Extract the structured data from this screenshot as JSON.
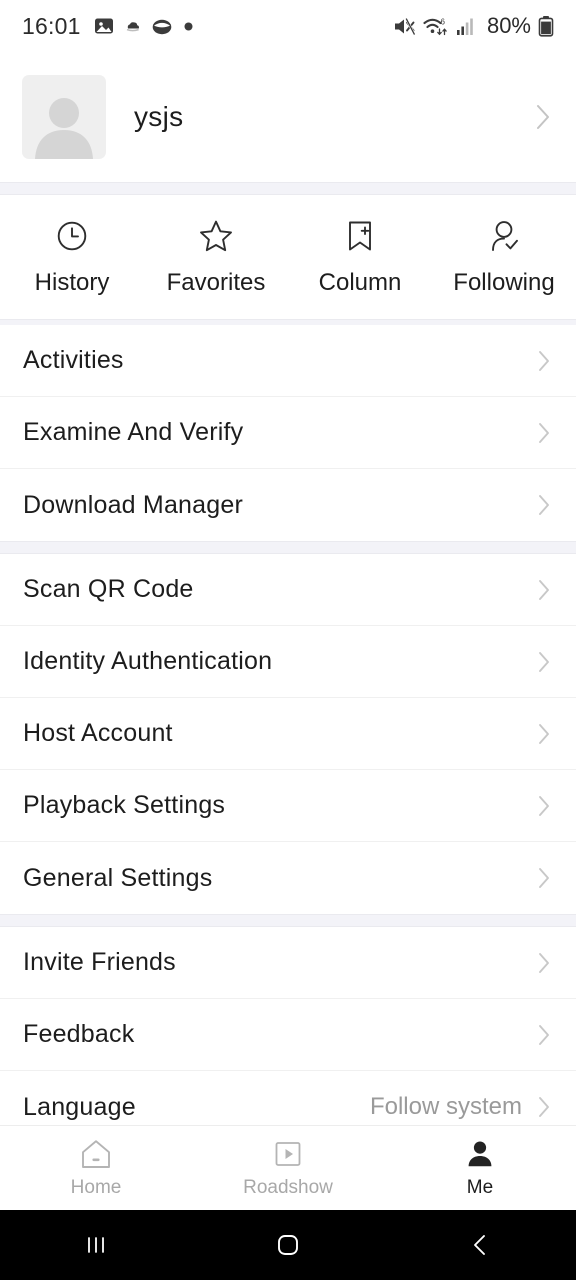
{
  "statusbar": {
    "clock": "16:01",
    "battery_percent": "80%",
    "left_icons": [
      "image-icon",
      "cloud-icon",
      "capsule-icon",
      "dot-icon"
    ],
    "right_icons": [
      "mute-icon",
      "wifi-6-icon",
      "signal-bars-icon",
      "battery-icon"
    ]
  },
  "profile": {
    "username": "ysjs",
    "avatar_icon": "default-user-avatar",
    "chevron_icon": "chevron-right-icon"
  },
  "quick_actions": [
    {
      "label": "History",
      "icon": "clock-icon"
    },
    {
      "label": "Favorites",
      "icon": "star-icon"
    },
    {
      "label": "Column",
      "icon": "bookmark-plus-icon"
    },
    {
      "label": "Following",
      "icon": "person-check-icon"
    }
  ],
  "menu_groups": [
    {
      "rows": [
        {
          "label": "Activities",
          "value": ""
        },
        {
          "label": "Examine And Verify",
          "value": ""
        },
        {
          "label": "Download Manager",
          "value": ""
        }
      ]
    },
    {
      "rows": [
        {
          "label": "Scan QR Code",
          "value": ""
        },
        {
          "label": "Identity Authentication",
          "value": ""
        },
        {
          "label": "Host Account",
          "value": ""
        },
        {
          "label": "Playback Settings",
          "value": ""
        },
        {
          "label": "General Settings",
          "value": ""
        }
      ]
    },
    {
      "rows": [
        {
          "label": "Invite Friends",
          "value": ""
        },
        {
          "label": "Feedback",
          "value": ""
        },
        {
          "label": "Language",
          "value": "Follow system"
        }
      ]
    }
  ],
  "tabbar": {
    "tabs": [
      {
        "label": "Home",
        "icon": "home-icon",
        "active": false
      },
      {
        "label": "Roadshow",
        "icon": "play-box-icon",
        "active": false
      },
      {
        "label": "Me",
        "icon": "person-filled-icon",
        "active": true
      }
    ]
  },
  "navbar": {
    "buttons": [
      {
        "name": "recents-button",
        "icon": "recents-icon"
      },
      {
        "name": "home-button",
        "icon": "home-circle-icon"
      },
      {
        "name": "back-button",
        "icon": "back-chevron-icon"
      }
    ]
  },
  "colors": {
    "background": "#ffffff",
    "band": "#f3f3f8",
    "text_primary": "#1d1d1d",
    "text_secondary": "#9a9a9a",
    "divider": "#f0f0f0",
    "navbar": "#000000"
  }
}
